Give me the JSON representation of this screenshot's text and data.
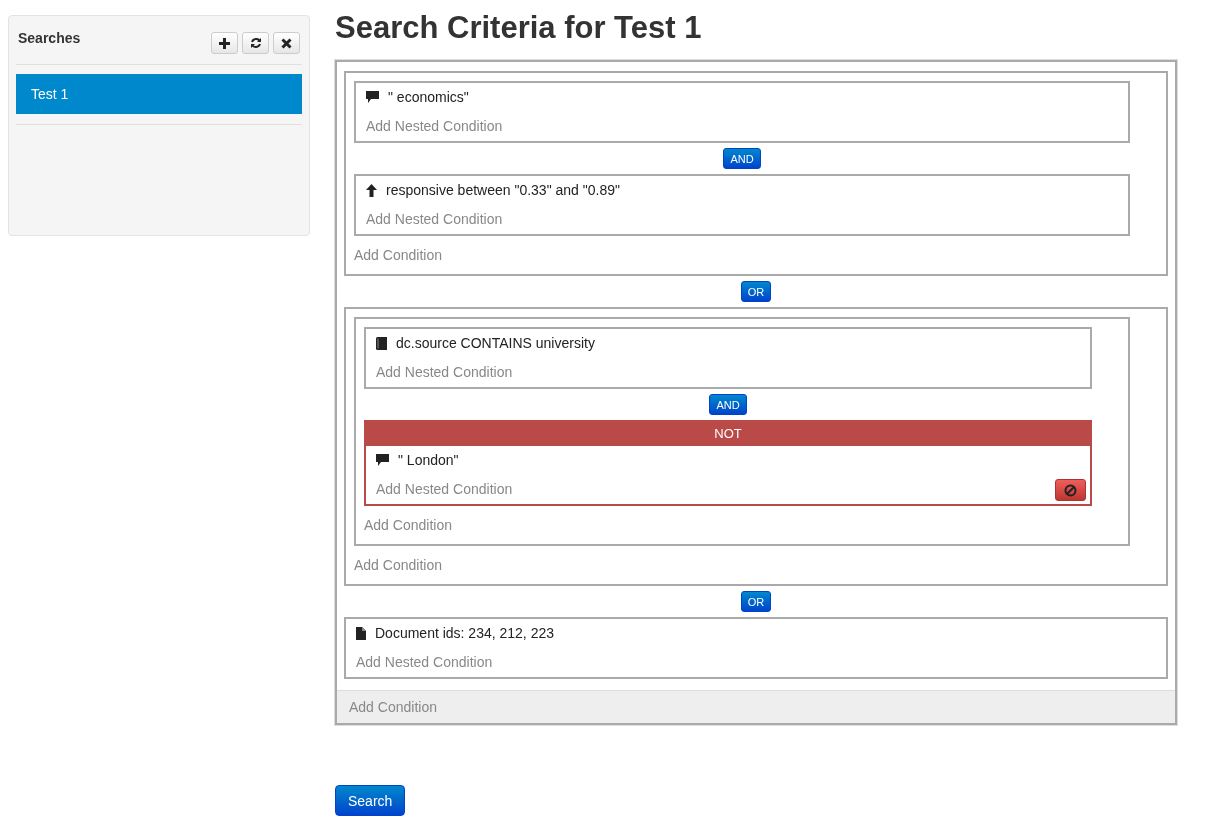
{
  "sidebar": {
    "title": "Searches",
    "items": [
      {
        "label": "Test 1",
        "selected": true
      }
    ]
  },
  "heading": "Search Criteria for Test 1",
  "criteria": {
    "footer": "Add Condition",
    "items": [
      {
        "kind": "group",
        "footer": "Add Condition",
        "items": [
          {
            "kind": "text",
            "text": "\" economics\"",
            "nested": "Add Nested Condition",
            "negated": false
          },
          {
            "kind": "joiner",
            "label": "AND"
          },
          {
            "kind": "range",
            "text": "responsive between \"0.33\" and \"0.89\"",
            "nested": "Add Nested Condition",
            "negated": false
          }
        ]
      },
      {
        "kind": "joiner",
        "label": "OR"
      },
      {
        "kind": "group",
        "footer": "Add Condition",
        "items": [
          {
            "kind": "group",
            "footer": "Add Condition",
            "items": [
              {
                "kind": "field",
                "text": "dc.source CONTAINS university",
                "nested": "Add Nested Condition",
                "negated": false
              },
              {
                "kind": "joiner",
                "label": "AND"
              },
              {
                "kind": "text",
                "text": "\" London\"",
                "nested": "Add Nested Condition",
                "negated": true,
                "not_label": "NOT"
              }
            ]
          }
        ]
      },
      {
        "kind": "joiner",
        "label": "OR"
      },
      {
        "kind": "ids",
        "text": "Document ids: 234, 212, 223",
        "nested": "Add Nested Condition",
        "negated": false
      }
    ]
  },
  "search_button": "Search"
}
